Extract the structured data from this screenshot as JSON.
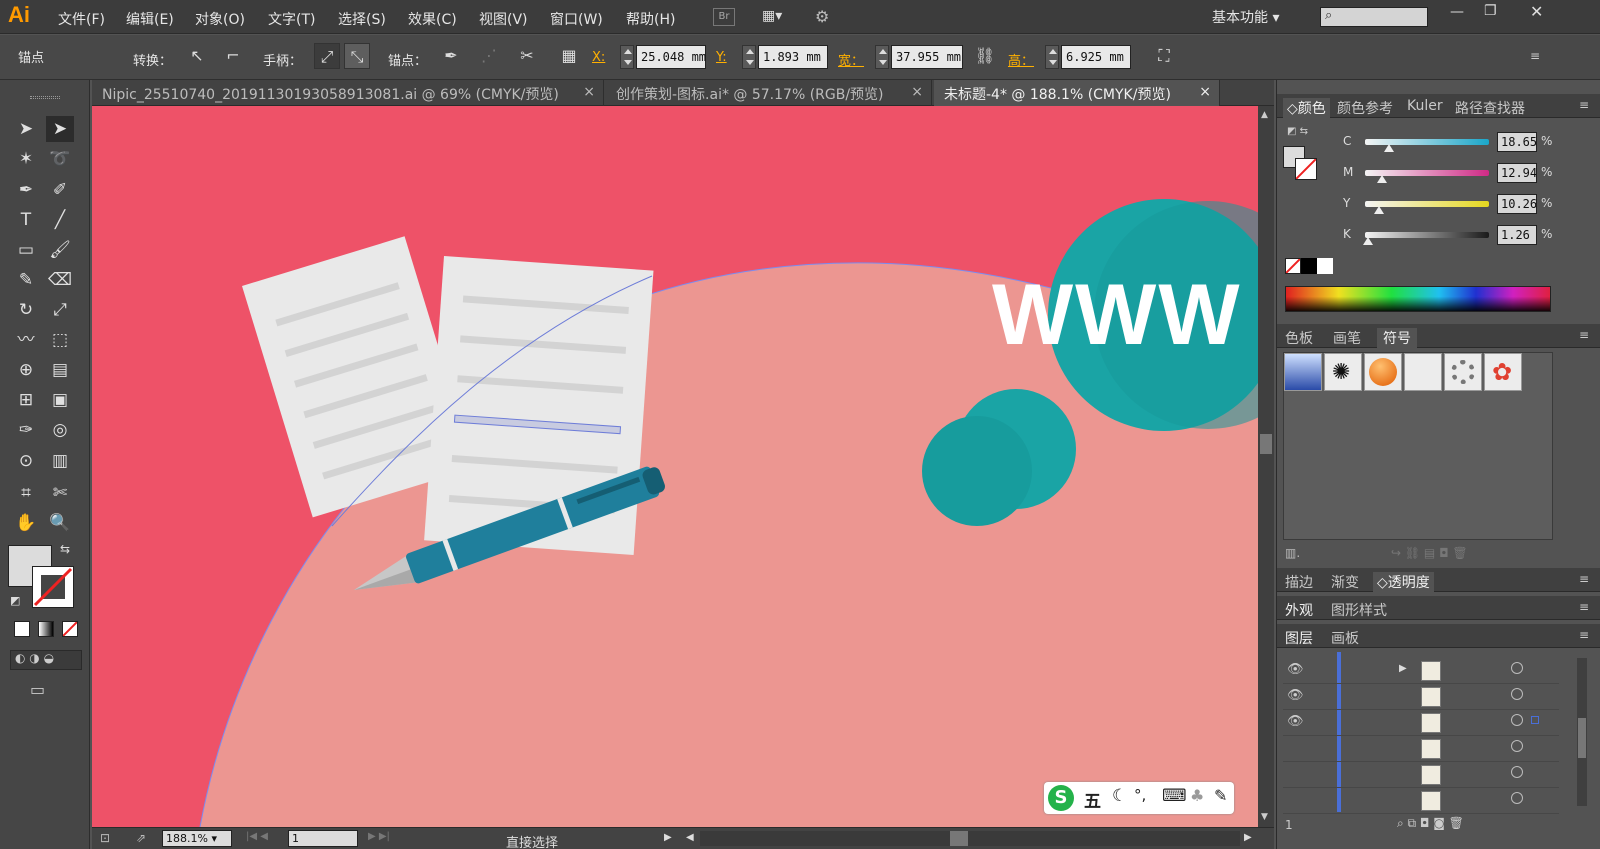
{
  "app": {
    "logo": "Ai"
  },
  "menu": [
    "文件(F)",
    "编辑(E)",
    "对象(O)",
    "文字(T)",
    "选择(S)",
    "效果(C)",
    "视图(V)",
    "窗口(W)",
    "帮助(H)"
  ],
  "menubar_right": {
    "bridge": "Br",
    "workspace": "基本功能",
    "search_placeholder": ""
  },
  "control_bar": {
    "context": "锚点",
    "convert_label": "转换：",
    "handles_label": "手柄：",
    "anchors_label": "锚点：",
    "x_label": "X:",
    "x_value": "25.048 mm",
    "y_label": "Y:",
    "y_value": "1.893 mm",
    "w_label": "宽：",
    "w_value": "37.955 mm",
    "h_label": "高：",
    "h_value": "6.925 mm"
  },
  "tabs": [
    {
      "label": "Nipic_25510740_20191130193058913081.ai @ 69% (CMYK/预览)",
      "close": "×"
    },
    {
      "label": "创作策划-图标.ai* @ 57.17% (RGB/预览)",
      "close": "×"
    },
    {
      "label": "未标题-4* @ 188.1% (CMYK/预览)",
      "close": "×",
      "active": true
    }
  ],
  "canvas": {
    "background": "#ee5268",
    "blob": "#ec9691",
    "teal": "#1aa4a5",
    "paper": "#e9e9e9",
    "paper_lines": "#d3d3d3",
    "pen": "#1f7f9c",
    "www_text": "WWW"
  },
  "status": {
    "zoom": "188.1%",
    "page": "1",
    "tool": "直接选择"
  },
  "color_panel": {
    "tabs": [
      "颜色",
      "颜色参考",
      "Kuler",
      "路径查找器"
    ],
    "channels": [
      {
        "label": "C",
        "value": "18.65",
        "unit": "%",
        "level": 0.1865,
        "color": "#1aa6c9"
      },
      {
        "label": "M",
        "value": "12.94",
        "unit": "%",
        "level": 0.1294,
        "color": "#d02a86"
      },
      {
        "label": "Y",
        "value": "10.26",
        "unit": "%",
        "level": 0.1026,
        "color": "#e6d81f"
      },
      {
        "label": "K",
        "value": "1.26",
        "unit": "%",
        "level": 0.0126,
        "color": "#1a1a1a"
      }
    ]
  },
  "swatch_panel": {
    "tabs": [
      "色板",
      "画笔",
      "符号"
    ]
  },
  "stroke_panel": {
    "tabs": [
      "描边",
      "渐变",
      "透明度"
    ]
  },
  "appearance_panel": {
    "tabs": [
      "外观",
      "图形样式"
    ]
  },
  "layers_panel": {
    "tabs": [
      "图层",
      "画板"
    ],
    "footer_count": "1",
    "rows": 6
  },
  "ime": {
    "mode": "五",
    "punct": "°,"
  }
}
